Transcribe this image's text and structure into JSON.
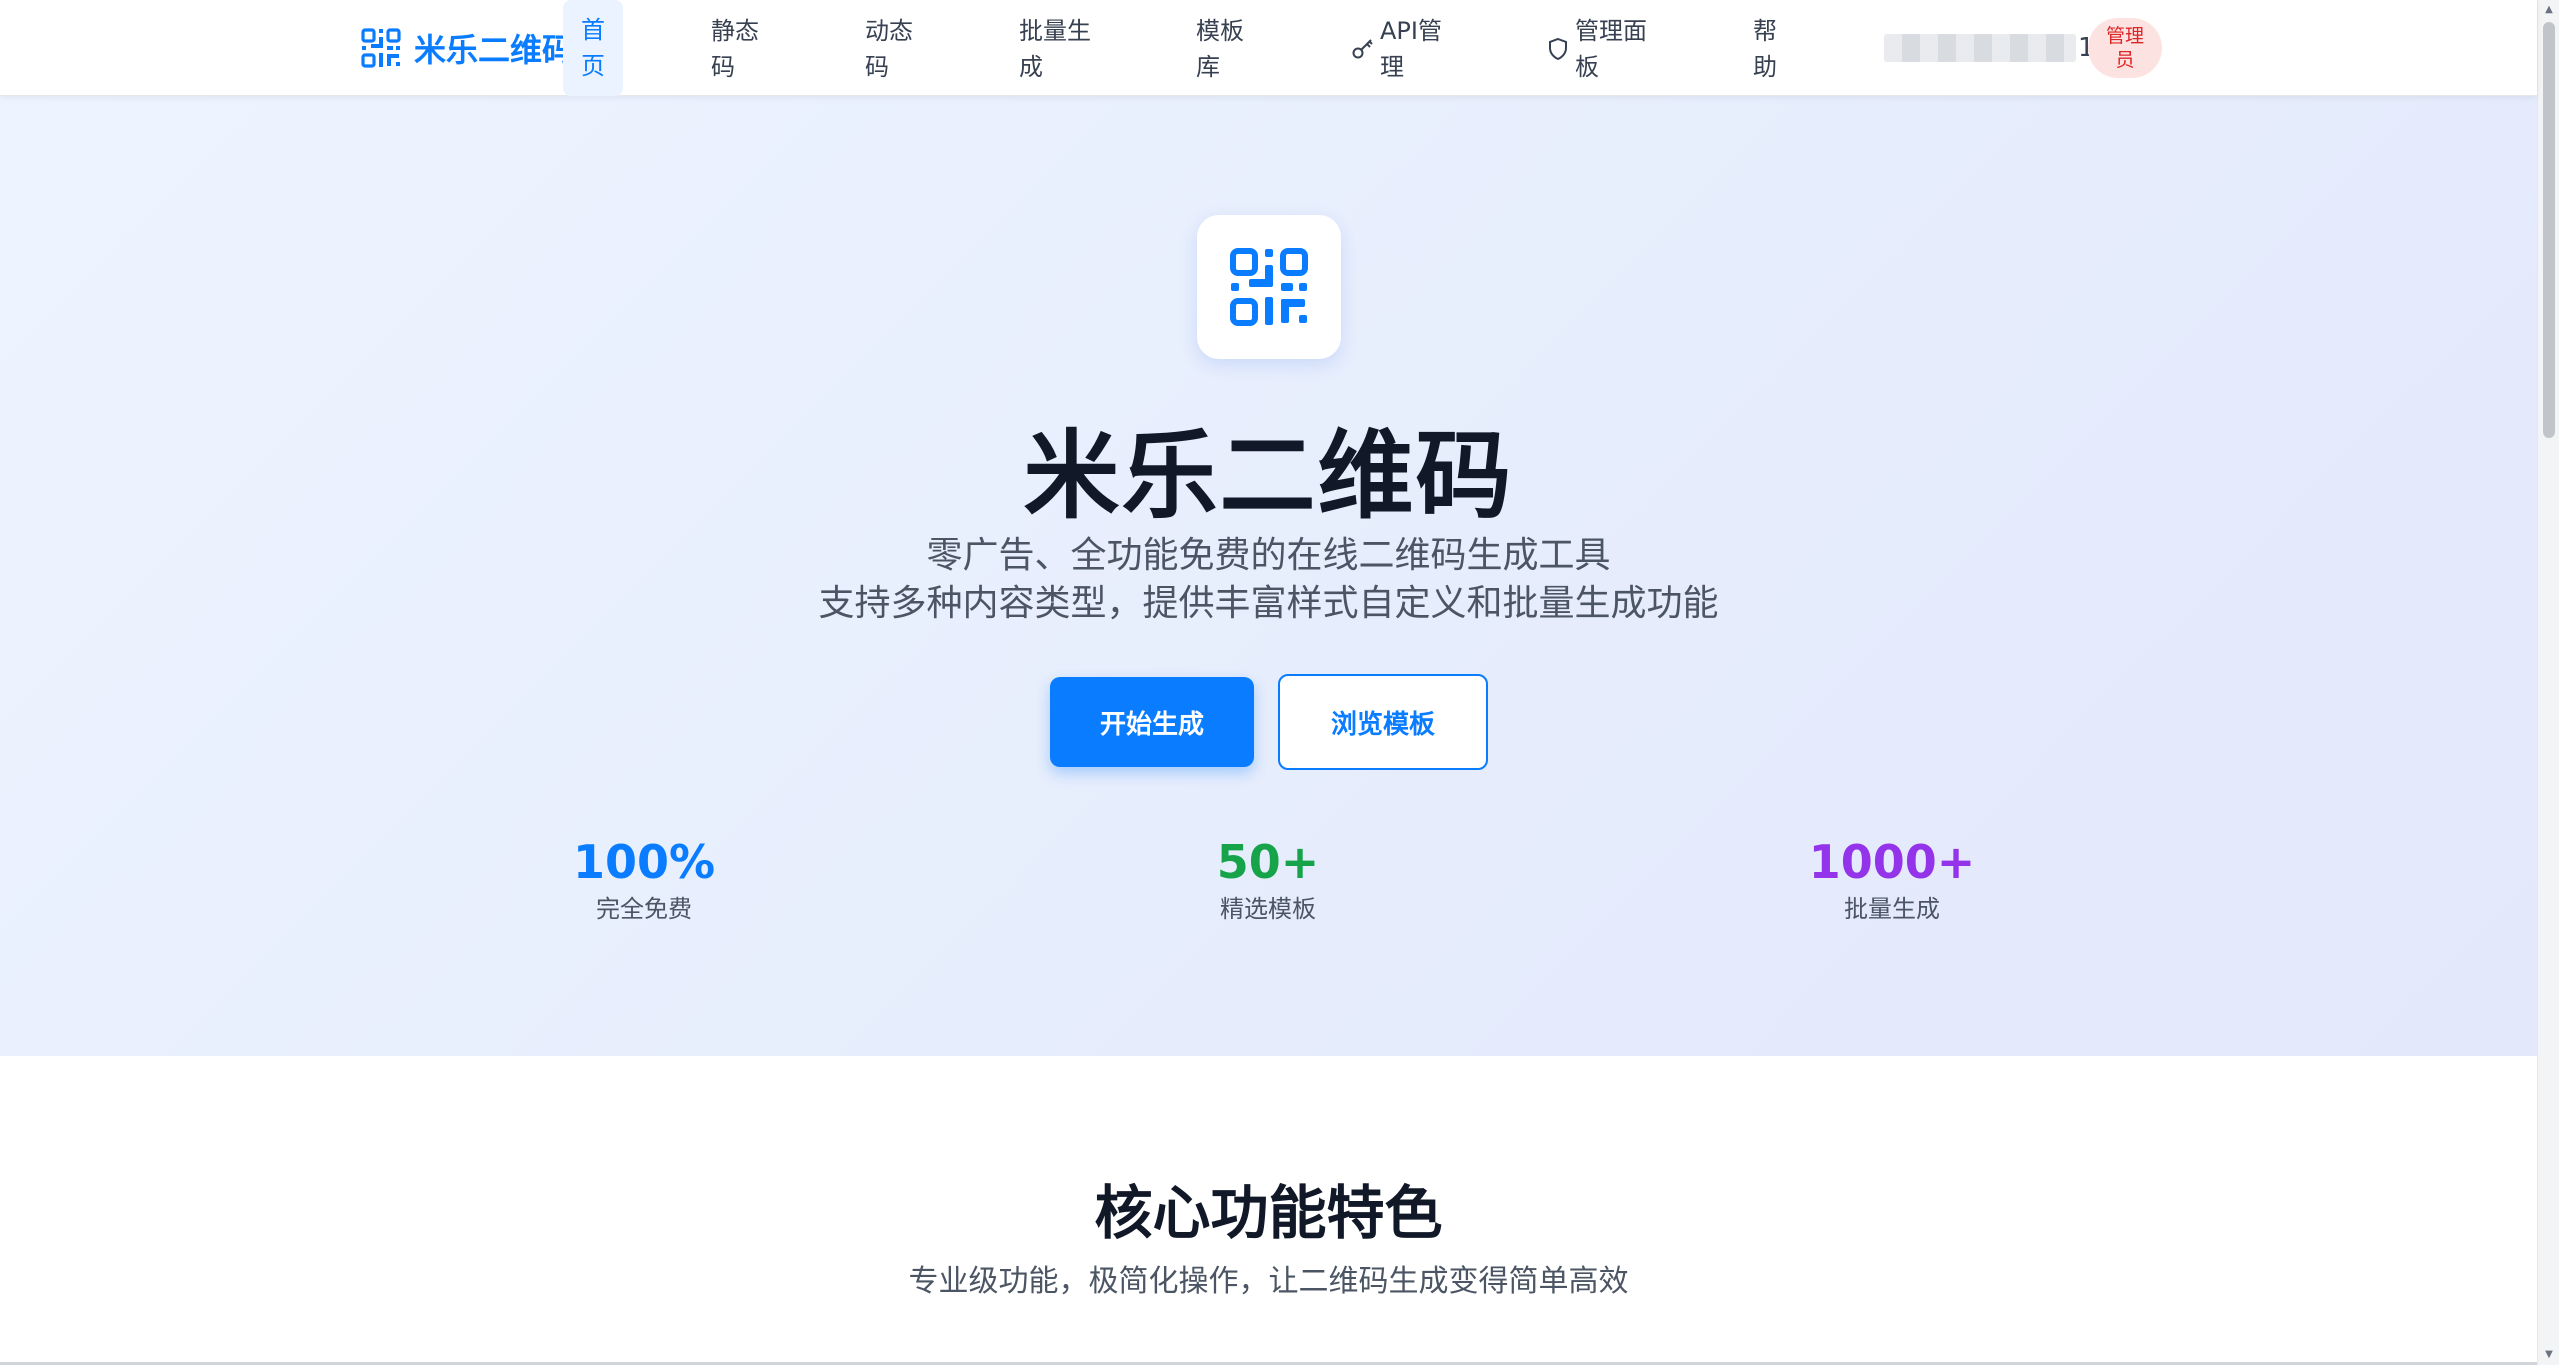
{
  "nav": {
    "brand": "米乐二维码",
    "items": [
      {
        "label": "首\n页",
        "icon": ""
      },
      {
        "label": "静态\n码",
        "icon": ""
      },
      {
        "label": "动态\n码",
        "icon": ""
      },
      {
        "label": "批量生\n成",
        "icon": ""
      },
      {
        "label": "模板\n库",
        "icon": ""
      },
      {
        "label": "API管\n理",
        "icon": "key-icon"
      },
      {
        "label": "管理面\n板",
        "icon": "shield-icon"
      },
      {
        "label": "帮\n助",
        "icon": ""
      }
    ],
    "user_suffix": "1",
    "admin_badge": "管理\n员"
  },
  "hero": {
    "title": "米乐二维码",
    "subtitle_line1": "零广告、全功能免费的在线二维码生成工具",
    "subtitle_line2": "支持多种内容类型，提供丰富样式自定义和批量生成功能",
    "primary_button": "开始生成",
    "secondary_button": "浏览模板",
    "stats": [
      {
        "value": "100%",
        "caption": "完全免费",
        "color": "#0a7cff"
      },
      {
        "value": "50+",
        "caption": "精选模板",
        "color": "#16a34a"
      },
      {
        "value": "1000+",
        "caption": "批量生成",
        "color": "#9333ea"
      }
    ]
  },
  "features": {
    "title": "核心功能特色",
    "subtitle": "专业级功能，极简化操作，让二维码生成变得简单高效"
  },
  "colors": {
    "accent": "#0a7cff",
    "danger": "#dc2626"
  }
}
